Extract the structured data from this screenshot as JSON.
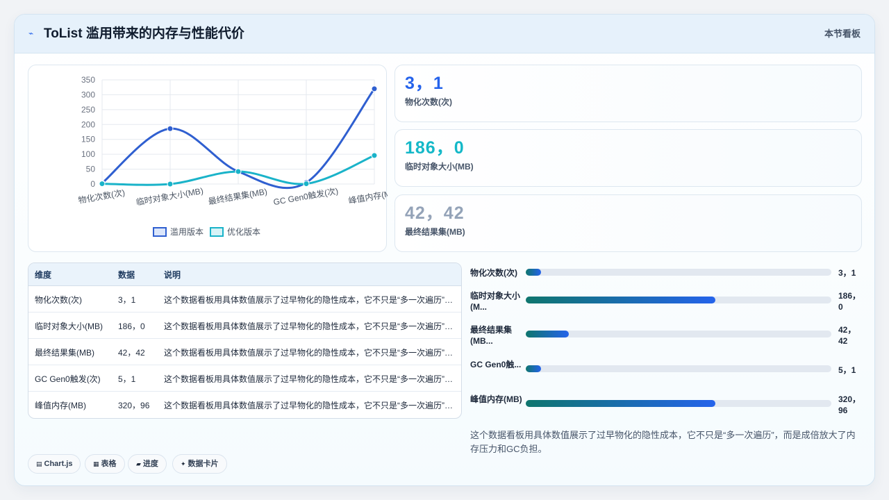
{
  "header": {
    "icon": "pulse-icon",
    "title": "ToList 滥用带来的内存与性能代价",
    "section_label": "本节看板"
  },
  "stats": [
    {
      "value": "3，1",
      "label": "物化次数(次)",
      "color": "#2563eb"
    },
    {
      "value": "186，0",
      "label": "临时对象大小(MB)",
      "color": "#14b8c8"
    },
    {
      "value": "42，42",
      "label": "最终结果集(MB)",
      "color": "#94a3b8"
    }
  ],
  "table": {
    "headers": [
      "维度",
      "数据",
      "说明"
    ],
    "rows": [
      {
        "dim": "物化次数(次)",
        "data": "3，1",
        "desc": "这个数据看板用具体数值展示了过早物化的隐性成本，它不只是“多一次遍历”，而是成倍放大了内存压力和GC负担。"
      },
      {
        "dim": "临时对象大小(MB)",
        "data": "186，0",
        "desc": "这个数据看板用具体数值展示了过早物化的隐性成本，它不只是“多一次遍历”，而是成倍放大了内存压力和GC负担。"
      },
      {
        "dim": "最终结果集(MB)",
        "data": "42，42",
        "desc": "这个数据看板用具体数值展示了过早物化的隐性成本，它不只是“多一次遍历”，而是成倍放大了内存压力和GC负担。"
      },
      {
        "dim": "GC Gen0触发(次)",
        "data": "5，1",
        "desc": "这个数据看板用具体数值展示了过早物化的隐性成本，它不只是“多一次遍历”，而是成倍放大了内存压力和GC负担。"
      },
      {
        "dim": "峰值内存(MB)",
        "data": "320，96",
        "desc": "这个数据看板用具体数值展示了过早物化的隐性成本，它不只是“多一次遍历”，而是成倍放大了内存压力和GC负担。"
      }
    ]
  },
  "progress": [
    {
      "label": "物化次数(次)",
      "value": "3，1",
      "fraction": 0.05
    },
    {
      "label": "临时对象大小(M...",
      "value": "186，0",
      "fraction": 0.62
    },
    {
      "label": "最终结果集(MB...",
      "value": "42，42",
      "fraction": 0.14
    },
    {
      "label": "GC Gen0触...",
      "value": "5，1",
      "fraction": 0.05
    },
    {
      "label": "峰值内存(MB)",
      "value": "320，96",
      "fraction": 0.62
    }
  ],
  "note": "这个数据看板用具体数值展示了过早物化的隐性成本，它不只是“多一次遍历”，而是成倍放大了内存压力和GC负担。",
  "tags": [
    {
      "icon": "chart-icon",
      "glyph": "▤",
      "label": "Chart.js"
    },
    {
      "icon": "table-icon",
      "glyph": "▦",
      "label": "表格"
    },
    {
      "icon": "progress-icon",
      "glyph": "▰",
      "label": "进度"
    },
    {
      "icon": "card-icon",
      "glyph": "✦",
      "label": "数据卡片"
    }
  ],
  "chart_data": {
    "type": "line",
    "categories": [
      "物化次数(次)",
      "临时对象大小(MB)",
      "最终结果集(MB)",
      "GC Gen0触发(次)",
      "峰值内存(MB)"
    ],
    "series": [
      {
        "name": "滥用版本",
        "values": [
          3,
          186,
          42,
          5,
          320
        ],
        "color": "#2f5fd0"
      },
      {
        "name": "优化版本",
        "values": [
          1,
          0,
          42,
          1,
          96
        ],
        "color": "#1ab3c9"
      }
    ],
    "ylim": [
      0,
      350
    ],
    "yticks": [
      0,
      50,
      100,
      150,
      200,
      250,
      300,
      350
    ],
    "grid": true,
    "legend": "bottom"
  }
}
